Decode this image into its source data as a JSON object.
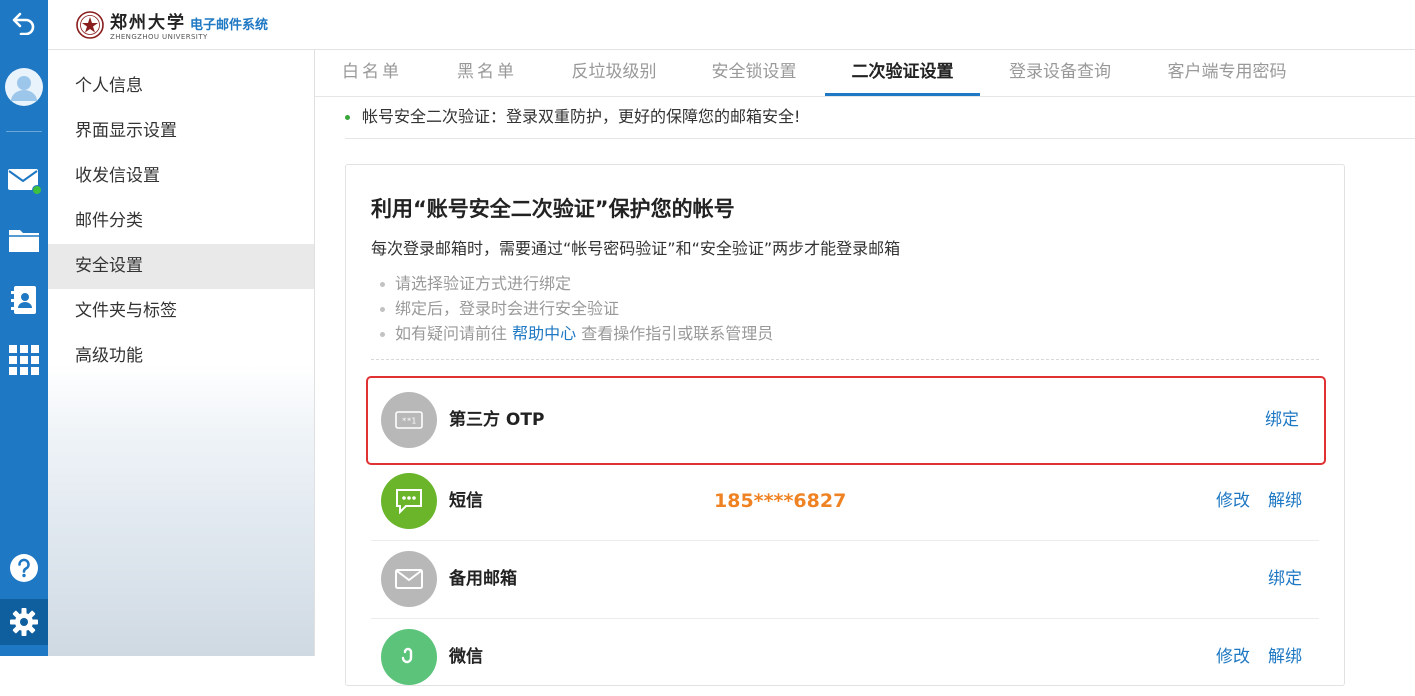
{
  "header": {
    "logo_name": "郑州大学",
    "logo_sub": "ZHENGZHOU UNIVERSITY",
    "product": "电子邮件系统"
  },
  "sidebar_nav": {
    "items": [
      {
        "label": "个人信息"
      },
      {
        "label": "界面显示设置"
      },
      {
        "label": "收发信设置"
      },
      {
        "label": "邮件分类"
      },
      {
        "label": "安全设置",
        "active": true
      },
      {
        "label": "文件夹与标签"
      },
      {
        "label": "高级功能"
      }
    ]
  },
  "tabs": [
    {
      "label": "白名单"
    },
    {
      "label": "黑名单"
    },
    {
      "label": "反垃圾级别"
    },
    {
      "label": "安全锁设置"
    },
    {
      "label": "二次验证设置",
      "active": true
    },
    {
      "label": "登录设备查询"
    },
    {
      "label": "客户端专用密码"
    }
  ],
  "notice": "帐号安全二次验证：登录双重防护，更好的保障您的邮箱安全!",
  "card": {
    "title": "利用“账号安全二次验证”保护您的帐号",
    "description": "每次登录邮箱时，需要通过“帐号密码验证”和“安全验证”两步才能登录邮箱",
    "tips": [
      "请选择验证方式进行绑定",
      "绑定后，登录时会进行安全验证"
    ],
    "tip3": {
      "prefix": "如有疑问请前往",
      "link": "帮助中心",
      "suffix": "查看操作指引或联系管理员"
    },
    "methods": [
      {
        "name": "第三方 OTP",
        "icon": "otp-key-icon",
        "actions": [
          "绑定"
        ]
      },
      {
        "name": "短信",
        "icon": "chat-bubble-icon",
        "phone": "185****6827",
        "actions": [
          "修改",
          "解绑"
        ]
      },
      {
        "name": "备用邮箱",
        "icon": "envelope-icon",
        "actions": [
          "绑定"
        ]
      },
      {
        "name": "微信",
        "icon": "wechat-icon",
        "actions": [
          "修改",
          "解绑"
        ]
      }
    ]
  },
  "colors": {
    "rail": "#1e78c3",
    "accent": "#1e78c3",
    "highlight": "#e03232",
    "phone": "#ef8324",
    "sms_icon": "#6ab52a",
    "wechat_icon": "#5bc47a",
    "gray_icon": "#b8b8b8"
  }
}
